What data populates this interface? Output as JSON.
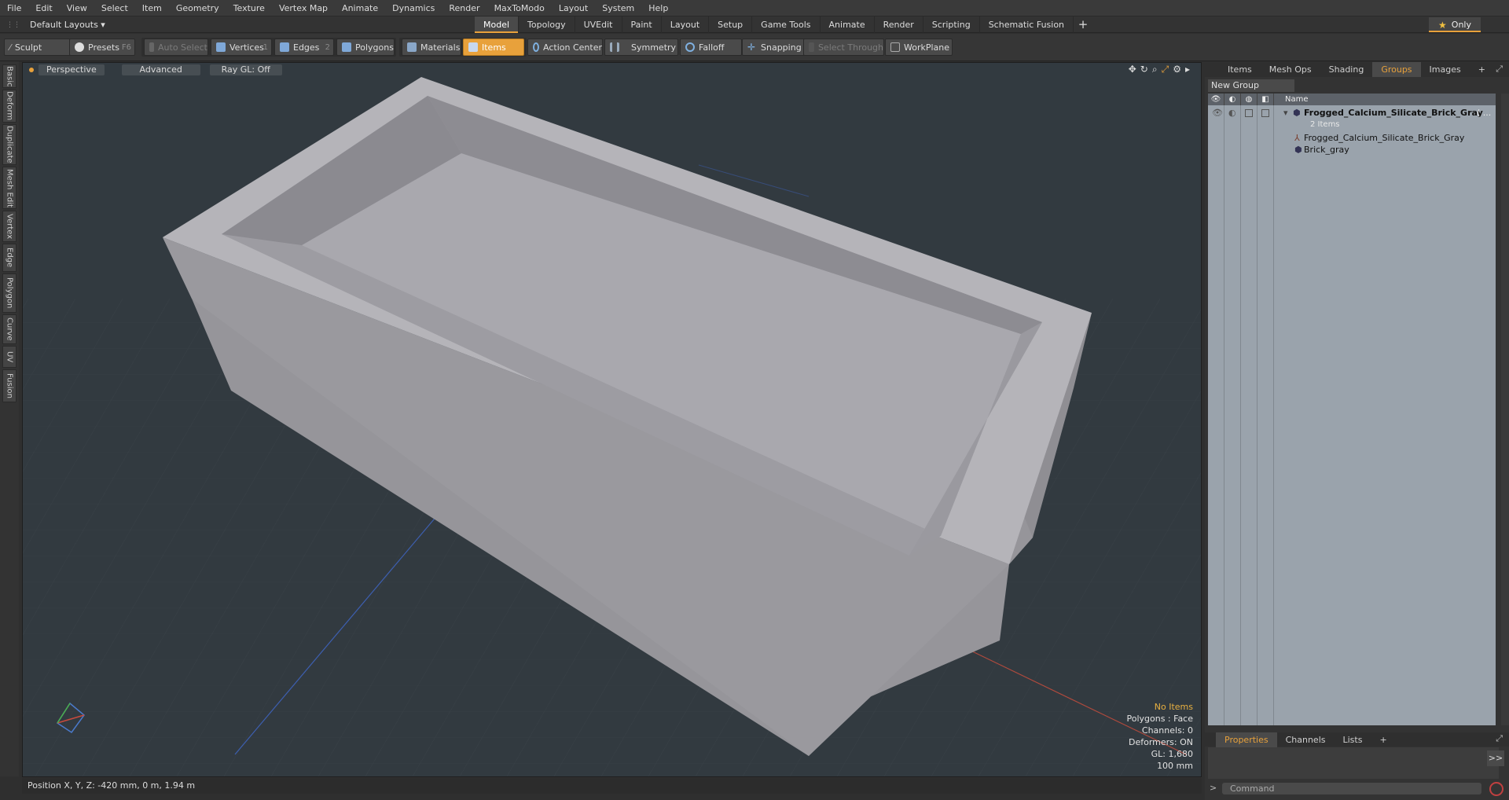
{
  "menu": [
    "File",
    "Edit",
    "View",
    "Select",
    "Item",
    "Geometry",
    "Texture",
    "Vertex Map",
    "Animate",
    "Dynamics",
    "Render",
    "MaxToModo",
    "Layout",
    "System",
    "Help"
  ],
  "layout_dropdown": "Default Layouts ▾",
  "tabs": [
    {
      "label": "Model",
      "active": true
    },
    {
      "label": "Topology"
    },
    {
      "label": "UVEdit"
    },
    {
      "label": "Paint"
    },
    {
      "label": "Layout"
    },
    {
      "label": "Setup"
    },
    {
      "label": "Game Tools"
    },
    {
      "label": "Animate"
    },
    {
      "label": "Render"
    },
    {
      "label": "Scripting"
    },
    {
      "label": "Schematic Fusion"
    }
  ],
  "tab_plus": "+",
  "only_label": "Only",
  "toolbar": {
    "sculpt": "Sculpt",
    "presets": "Presets",
    "presets_key": "F6",
    "auto_select": "Auto Select",
    "vertices": "Vertices",
    "vertices_key": "1",
    "edges": "Edges",
    "edges_key": "2",
    "polygons": "Polygons",
    "materials": "Materials",
    "items": "Items",
    "action_center": "Action Center",
    "symmetry": "Symmetry",
    "falloff": "Falloff",
    "snapping": "Snapping",
    "select_through": "Select Through",
    "workplane": "WorkPlane"
  },
  "left_tabs": [
    "Basic",
    "Deform",
    "Duplicate",
    "Mesh Edit",
    "Vertex",
    "Edge",
    "Polygon",
    "Curve",
    "UV",
    "Fusion"
  ],
  "viewport": {
    "perspective": "Perspective",
    "advanced": "Advanced",
    "raygl": "Ray GL: Off",
    "info": {
      "no_items": "No Items",
      "polygons": "Polygons : Face",
      "channels": "Channels: 0",
      "deformers": "Deformers: ON",
      "gl": "GL: 1,680",
      "scale": "100 mm"
    }
  },
  "status": "Position X, Y, Z:   -420 mm, 0 m, 1.94 m",
  "right_panel": {
    "tabs": [
      "Items",
      "Mesh Ops",
      "Shading",
      "Groups",
      "Images"
    ],
    "active_tab": "Groups",
    "tab_plus": "+",
    "new_group": "New Group",
    "col_name": "Name",
    "group_name": "Frogged_Calcium_Silicate_Brick_Gray",
    "group_suffix": "( ...",
    "group_count": "2 Items",
    "children": [
      "Frogged_Calcium_Silicate_Brick_Gray",
      "Brick_gray"
    ]
  },
  "bottom_panel": {
    "tabs": [
      "Properties",
      "Channels",
      "Lists"
    ],
    "active_tab": "Properties",
    "tab_plus": "+",
    "arrow_btn": ">>",
    "command_placeholder": "Command"
  },
  "colors": {
    "accent": "#e8a13b",
    "viewport_bg": "#323a40",
    "list_bg": "#9aa3ac"
  }
}
